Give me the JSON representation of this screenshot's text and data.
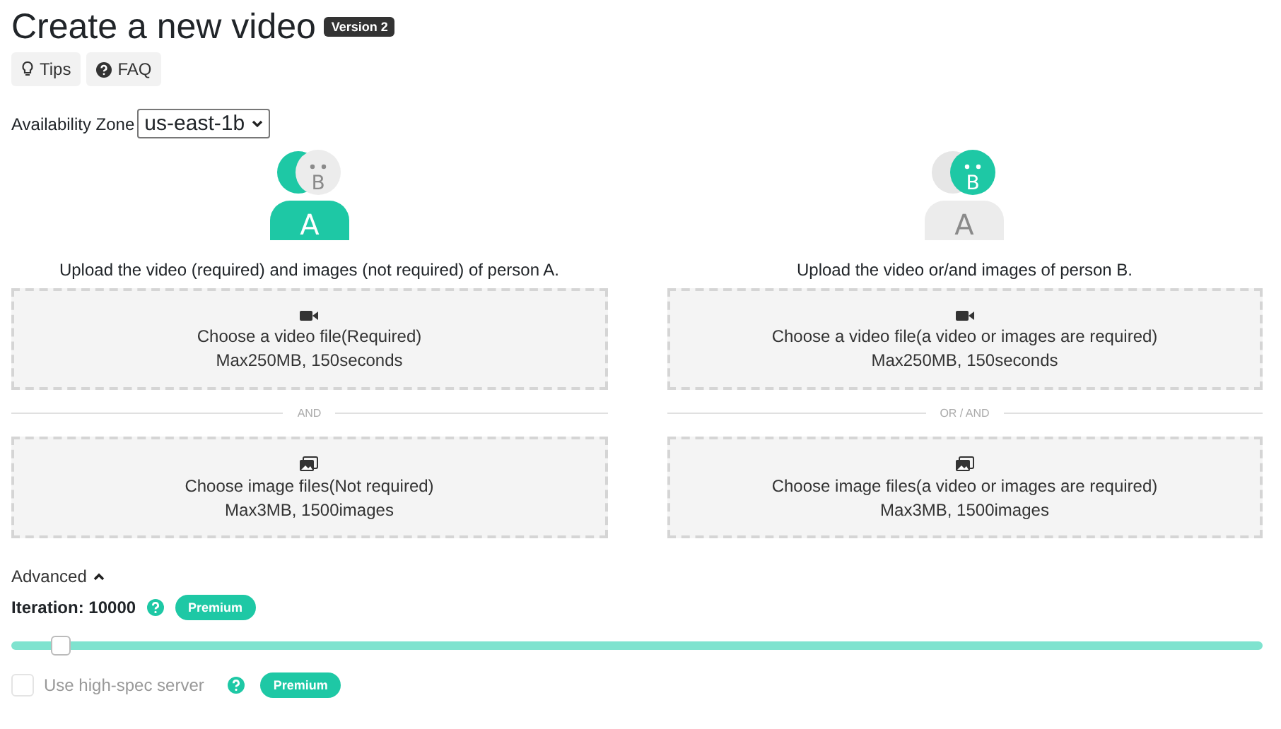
{
  "title": "Create a new video",
  "version_badge": "Version 2",
  "help_buttons": [
    {
      "label": "Tips",
      "kind": "bulb"
    },
    {
      "label": "FAQ",
      "kind": "question"
    }
  ],
  "availability_zone": {
    "label": "Availability Zone",
    "value": "us-east-1b"
  },
  "persons": [
    {
      "avatar": {
        "body_label": "A",
        "head_label": "B",
        "head_highlighted": false
      },
      "caption": "Upload the video (required) and images (not required) of person A.",
      "video_drop": {
        "title": "Choose a video file(Required)",
        "limit": "Max250MB, 150seconds"
      },
      "separator": "AND",
      "image_drop": {
        "title": "Choose image files(Not required)",
        "limit": "Max3MB, 1500images"
      }
    },
    {
      "avatar": {
        "body_label": "A",
        "head_label": "B",
        "head_highlighted": true
      },
      "caption": "Upload the video or/and images of person B.",
      "video_drop": {
        "title": "Choose a video file(a video or images are required)",
        "limit": "Max250MB, 150seconds"
      },
      "separator": "OR / AND",
      "image_drop": {
        "title": "Choose image files(a video or images are required)",
        "limit": "Max3MB, 1500images"
      }
    }
  ],
  "advanced": {
    "label": "Advanced",
    "expanded": true
  },
  "iteration": {
    "label": "Iteration: 10000",
    "badge": "Premium",
    "level": 0.04
  },
  "high_spec": {
    "label": "Use high-spec server",
    "checked": false,
    "disabled": true,
    "badge": "Premium"
  }
}
